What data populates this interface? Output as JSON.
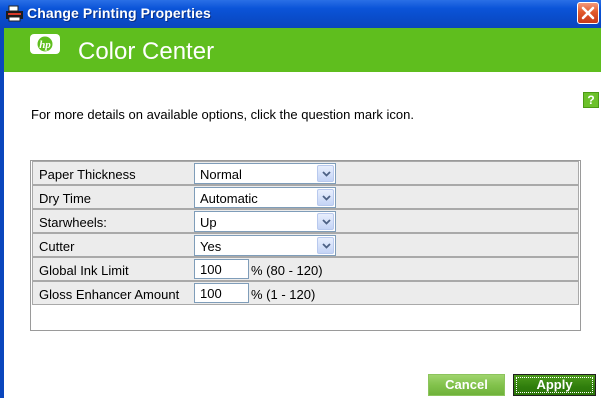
{
  "window": {
    "title": "Change Printing Properties",
    "icon": "printer-icon",
    "close_icon": "close-icon"
  },
  "banner": {
    "logo": "hp-logo",
    "title": "Color Center",
    "color": "#5fbe1e"
  },
  "info": {
    "text": "For more details on available options, click the question mark icon.",
    "help_glyph": "?"
  },
  "properties": [
    {
      "label": "Paper Thickness",
      "type": "select",
      "value": "Normal"
    },
    {
      "label": "Dry Time",
      "type": "select",
      "value": "Automatic"
    },
    {
      "label": "Starwheels:",
      "type": "select",
      "value": "Up"
    },
    {
      "label": "Cutter",
      "type": "select",
      "value": "Yes"
    },
    {
      "label": "Global Ink Limit",
      "type": "number",
      "value": "100",
      "range": "% (80 - 120)"
    },
    {
      "label": "Gloss Enhancer Amount",
      "type": "number",
      "value": "100",
      "range": "% (1 - 120)"
    }
  ],
  "buttons": {
    "cancel": "Cancel",
    "apply": "Apply"
  },
  "colors": {
    "titlebar": "#0a4bc8",
    "button_light": "#82c24c",
    "button_dark": "#2f7d0c"
  }
}
